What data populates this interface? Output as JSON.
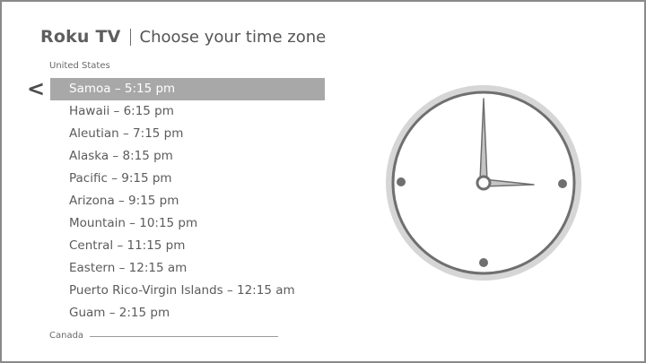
{
  "header": {
    "brand": "Roku TV",
    "title": "Choose your time zone"
  },
  "back_symbol": "<",
  "sections": {
    "united_states": "United States",
    "canada": "Canada"
  },
  "time_zones": [
    {
      "label": "Samoa – 5:15 pm",
      "selected": true
    },
    {
      "label": "Hawaii – 6:15 pm",
      "selected": false
    },
    {
      "label": "Aleutian – 7:15 pm",
      "selected": false
    },
    {
      "label": "Alaska – 8:15 pm",
      "selected": false
    },
    {
      "label": "Pacific – 9:15 pm",
      "selected": false
    },
    {
      "label": "Arizona – 9:15 pm",
      "selected": false
    },
    {
      "label": "Mountain – 10:15 pm",
      "selected": false
    },
    {
      "label": "Central – 11:15 pm",
      "selected": false
    },
    {
      "label": "Eastern – 12:15 am",
      "selected": false
    },
    {
      "label": "Puerto Rico-Virgin Islands – 12:15 am",
      "selected": false
    },
    {
      "label": "Guam – 2:15 pm",
      "selected": false
    }
  ],
  "colors": {
    "selection": "#a8a8a8",
    "clock_ring": "#d6d6d6",
    "clock_stroke": "#6f6f6f",
    "text": "#5b5b5b"
  },
  "clock": {
    "icon": "analog-clock-icon"
  }
}
